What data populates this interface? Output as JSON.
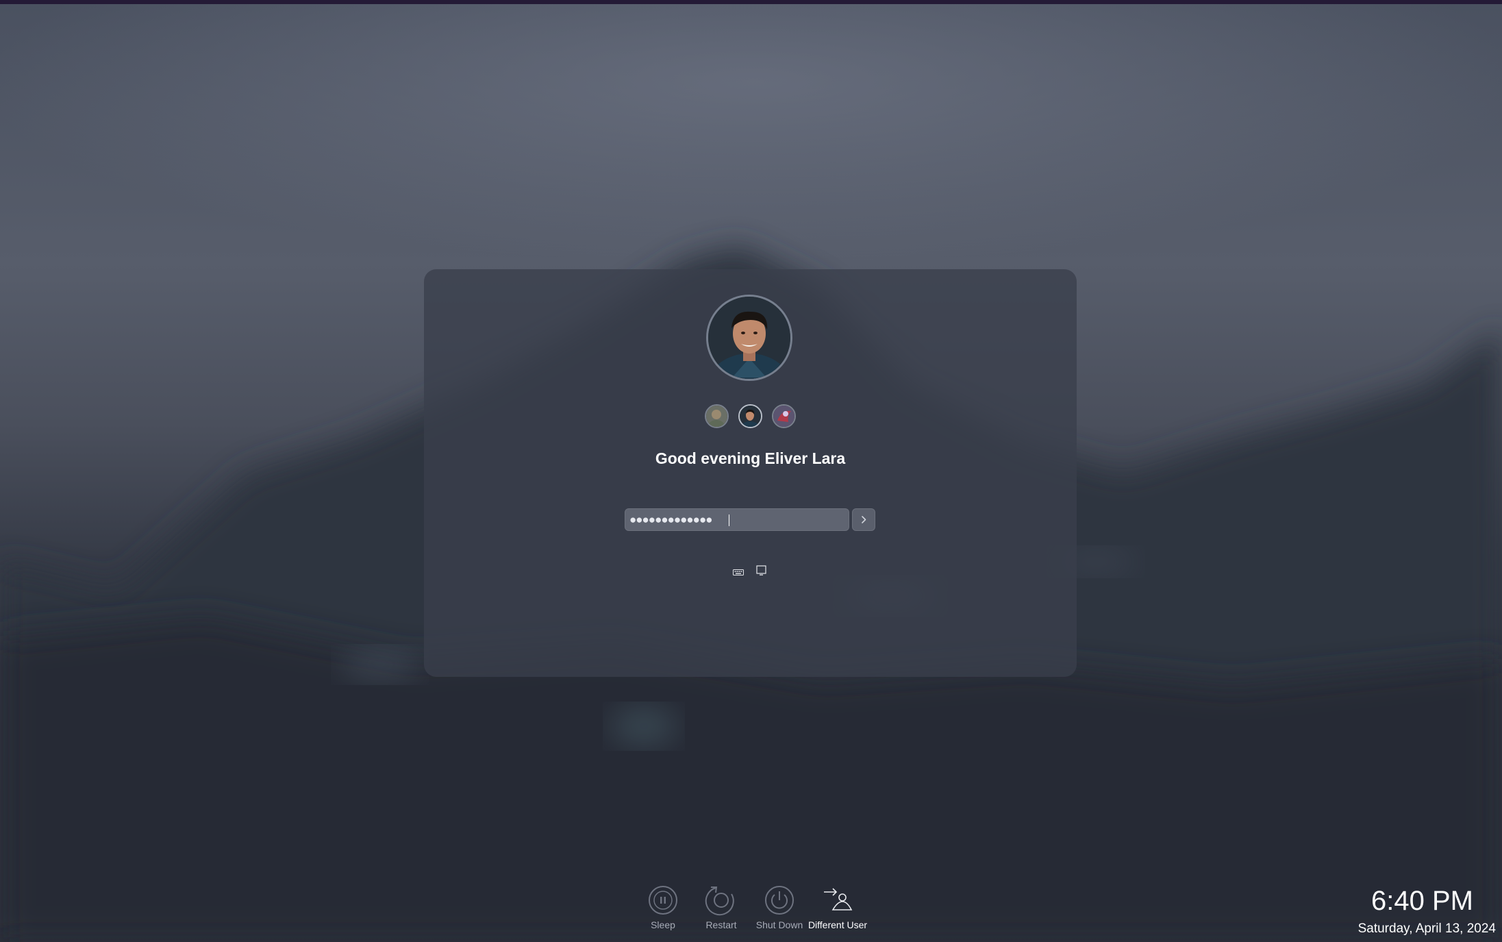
{
  "login": {
    "greeting": "Good evening Eliver Lara",
    "password_masked": "●●●●●●●●●●●●●",
    "users": [
      "user-1",
      "user-2-current",
      "user-3"
    ]
  },
  "power_menu": {
    "sleep_label": "Sleep",
    "restart_label": "Restart",
    "shutdown_label": "Shut Down",
    "different_user_label": "Different User"
  },
  "clock": {
    "time": "6:40 PM",
    "date": "Saturday, April 13, 2024"
  },
  "icons": {
    "sleep": "sleep-icon",
    "restart": "restart-icon",
    "shutdown": "power-icon",
    "different_user": "switch-user-icon",
    "submit": "chevron-right-icon",
    "keyboard": "keyboard-icon",
    "accessibility": "screen-icon"
  },
  "colors": {
    "card": "#3a3f4c",
    "text": "#ffffff",
    "muted_text": "#a8acb6"
  }
}
